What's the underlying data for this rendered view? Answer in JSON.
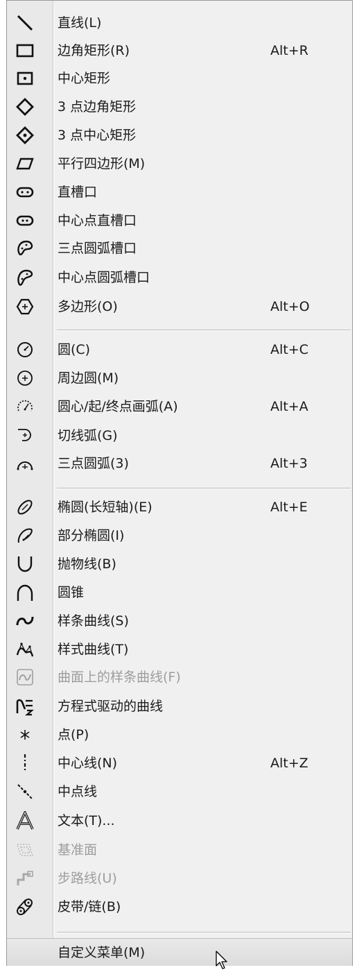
{
  "menu": {
    "items": [
      {
        "label": "直线(L)",
        "shortcut": "",
        "icon": "line-icon",
        "enabled": true
      },
      {
        "label": "边角矩形(R)",
        "shortcut": "Alt+R",
        "icon": "corner-rectangle-icon",
        "enabled": true
      },
      {
        "label": "中心矩形",
        "shortcut": "",
        "icon": "center-rectangle-icon",
        "enabled": true
      },
      {
        "label": "3 点边角矩形",
        "shortcut": "",
        "icon": "three-point-corner-rectangle-icon",
        "enabled": true
      },
      {
        "label": "3 点中心矩形",
        "shortcut": "",
        "icon": "three-point-center-rectangle-icon",
        "enabled": true
      },
      {
        "label": "平行四边形(M)",
        "shortcut": "",
        "icon": "parallelogram-icon",
        "enabled": true
      },
      {
        "label": "直槽口",
        "shortcut": "",
        "icon": "straight-slot-icon",
        "enabled": true
      },
      {
        "label": "中心点直槽口",
        "shortcut": "",
        "icon": "centerpoint-straight-slot-icon",
        "enabled": true
      },
      {
        "label": "三点圆弧槽口",
        "shortcut": "",
        "icon": "three-point-arc-slot-icon",
        "enabled": true
      },
      {
        "label": "中心点圆弧槽口",
        "shortcut": "",
        "icon": "centerpoint-arc-slot-icon",
        "enabled": true
      },
      {
        "label": "多边形(O)",
        "shortcut": "Alt+O",
        "icon": "polygon-icon",
        "enabled": true
      },
      {
        "label": "圆(C)",
        "shortcut": "Alt+C",
        "icon": "circle-icon",
        "enabled": true
      },
      {
        "label": "周边圆(M)",
        "shortcut": "",
        "icon": "perimeter-circle-icon",
        "enabled": true
      },
      {
        "label": "圆心/起/终点画弧(A)",
        "shortcut": "Alt+A",
        "icon": "centerpoint-arc-icon",
        "enabled": true
      },
      {
        "label": "切线弧(G)",
        "shortcut": "",
        "icon": "tangent-arc-icon",
        "enabled": true
      },
      {
        "label": "三点圆弧(3)",
        "shortcut": "Alt+3",
        "icon": "three-point-arc-icon",
        "enabled": true
      },
      {
        "label": "椭圆(长短轴)(E)",
        "shortcut": "Alt+E",
        "icon": "ellipse-icon",
        "enabled": true
      },
      {
        "label": "部分椭圆(I)",
        "shortcut": "",
        "icon": "partial-ellipse-icon",
        "enabled": true
      },
      {
        "label": "抛物线(B)",
        "shortcut": "",
        "icon": "parabola-icon",
        "enabled": true
      },
      {
        "label": "圆锥",
        "shortcut": "",
        "icon": "conic-icon",
        "enabled": true
      },
      {
        "label": "样条曲线(S)",
        "shortcut": "",
        "icon": "spline-icon",
        "enabled": true
      },
      {
        "label": "样式曲线(T)",
        "shortcut": "",
        "icon": "style-spline-icon",
        "enabled": true
      },
      {
        "label": "曲面上的样条曲线(F)",
        "shortcut": "",
        "icon": "spline-on-surface-icon",
        "enabled": false
      },
      {
        "label": "方程式驱动的曲线",
        "shortcut": "",
        "icon": "equation-curve-icon",
        "enabled": true
      },
      {
        "label": "点(P)",
        "shortcut": "",
        "icon": "point-icon",
        "enabled": true
      },
      {
        "label": "中心线(N)",
        "shortcut": "Alt+Z",
        "icon": "centerline-icon",
        "enabled": true
      },
      {
        "label": "中点线",
        "shortcut": "",
        "icon": "midpoint-line-icon",
        "enabled": true
      },
      {
        "label": "文本(T)...",
        "shortcut": "",
        "icon": "text-icon",
        "enabled": true
      },
      {
        "label": "基准面",
        "shortcut": "",
        "icon": "plane-icon",
        "enabled": false
      },
      {
        "label": "步路线(U)",
        "shortcut": "",
        "icon": "route-line-icon",
        "enabled": false
      },
      {
        "label": "皮带/链(B)",
        "shortcut": "",
        "icon": "belt-chain-icon",
        "enabled": true
      }
    ],
    "customize": {
      "label": "自定义菜单(M)"
    }
  }
}
